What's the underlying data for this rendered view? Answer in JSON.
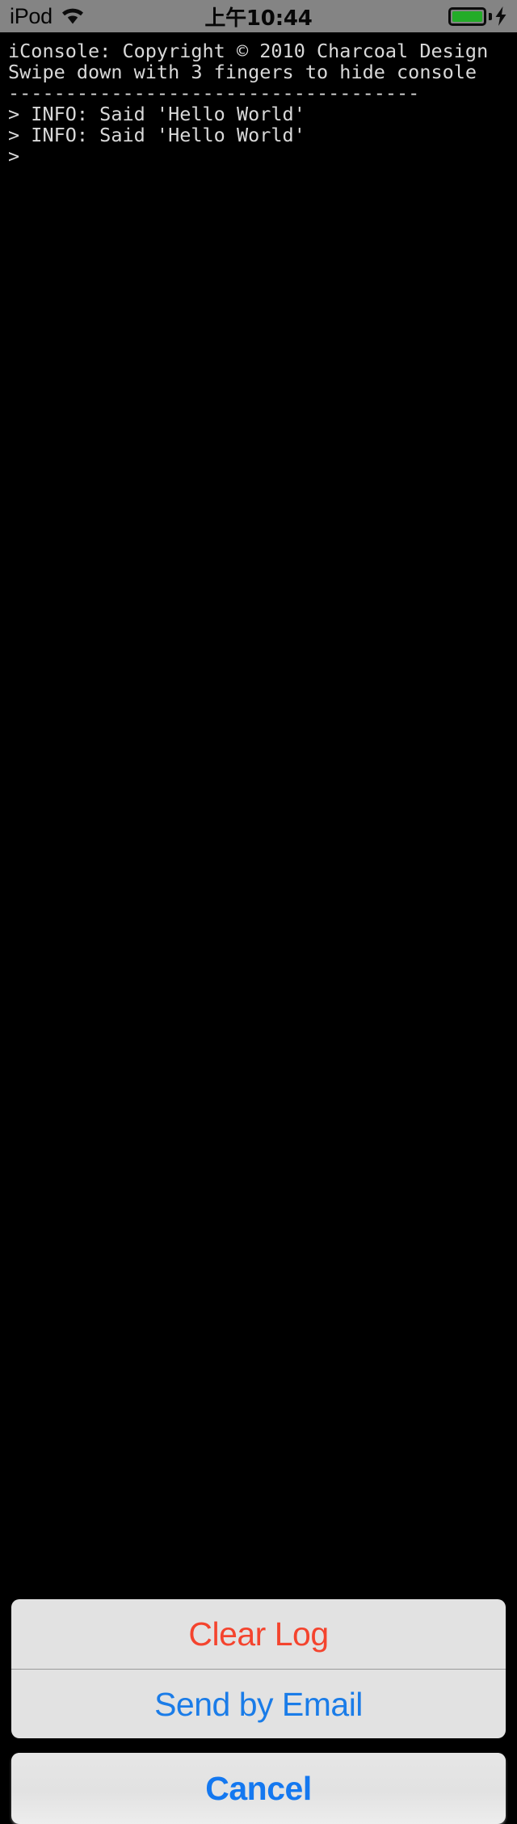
{
  "status_bar": {
    "carrier": "iPod",
    "wifi_icon": "wifi-icon",
    "time": "上午10:44",
    "battery_icon": "battery-full-icon",
    "charging_icon": "lightning-bolt-icon",
    "background_color": "#848484",
    "battery_color": "#23ac28"
  },
  "console": {
    "text": "iConsole: Copyright © 2010 Charcoal Design\nSwipe down with 3 fingers to hide console\n------------------------------------\n> INFO: Said 'Hello World'\n> INFO: Said 'Hello World'\n>",
    "lines": [
      "iConsole: Copyright © 2010 Charcoal Design",
      "Swipe down with 3 fingers to hide console",
      "------------------------------------",
      "> INFO: Said 'Hello World'",
      "> INFO: Said 'Hello World'",
      ">"
    ],
    "background_color": "#000000",
    "text_color": "#d9d9d9"
  },
  "action_sheet": {
    "buttons": [
      {
        "label": "Clear Log",
        "color": "#f4442e",
        "style": "destructive"
      },
      {
        "label": "Send by Email",
        "color": "#1a7ce8",
        "style": "default"
      }
    ],
    "cancel": {
      "label": "Cancel",
      "color": "#1478f0",
      "style": "cancel"
    },
    "panel_color": "#e2e2e2"
  }
}
